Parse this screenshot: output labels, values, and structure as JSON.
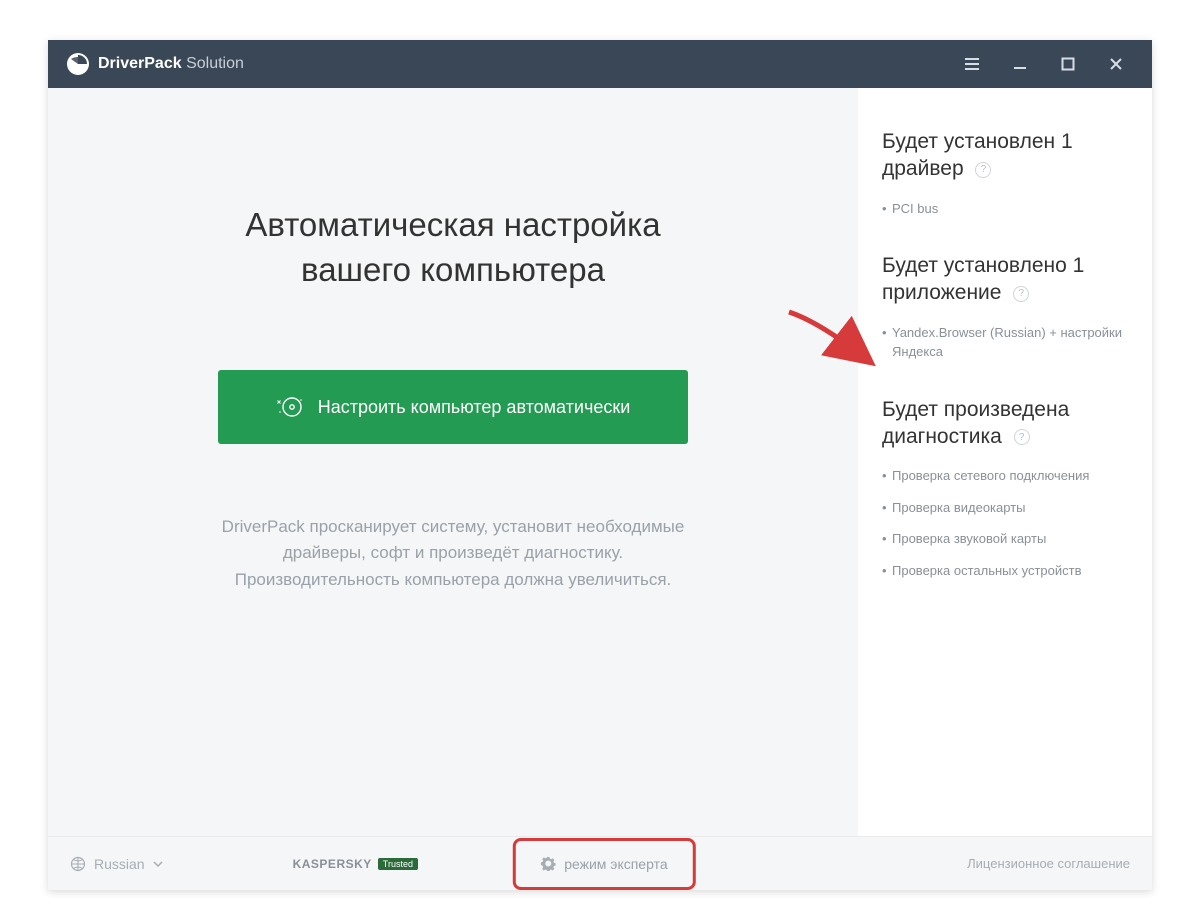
{
  "app": {
    "brand_bold": "DriverPack",
    "brand_light": " Solution"
  },
  "main": {
    "headline_line1": "Автоматическая настройка",
    "headline_line2": "вашего компьютера",
    "cta_label": "Настроить компьютер автоматически",
    "description_line1": "DriverPack просканирует систему, установит необходимые",
    "description_line2": "драйверы, софт и произведёт диагностику.",
    "description_line3": "Производительность компьютера должна увеличиться."
  },
  "sidebar": {
    "sections": [
      {
        "title": "Будет установлен 1 драйвер",
        "items": [
          "PCI bus"
        ]
      },
      {
        "title": "Будет установлено 1 приложение",
        "items": [
          "Yandex.Browser (Russian) + настройки Яндекса"
        ]
      },
      {
        "title": "Будет произведена диагностика",
        "items": [
          "Проверка сетевого подключения",
          "Проверка видеокарты",
          "Проверка звуковой карты",
          "Проверка остальных устройств"
        ]
      }
    ],
    "help_glyph": "?"
  },
  "footer": {
    "language": "Russian",
    "kaspersky_brand": "KASPERSKY",
    "kaspersky_badge": "Trusted",
    "expert_mode": "режим эксперта",
    "license": "Лицензионное соглашение"
  }
}
